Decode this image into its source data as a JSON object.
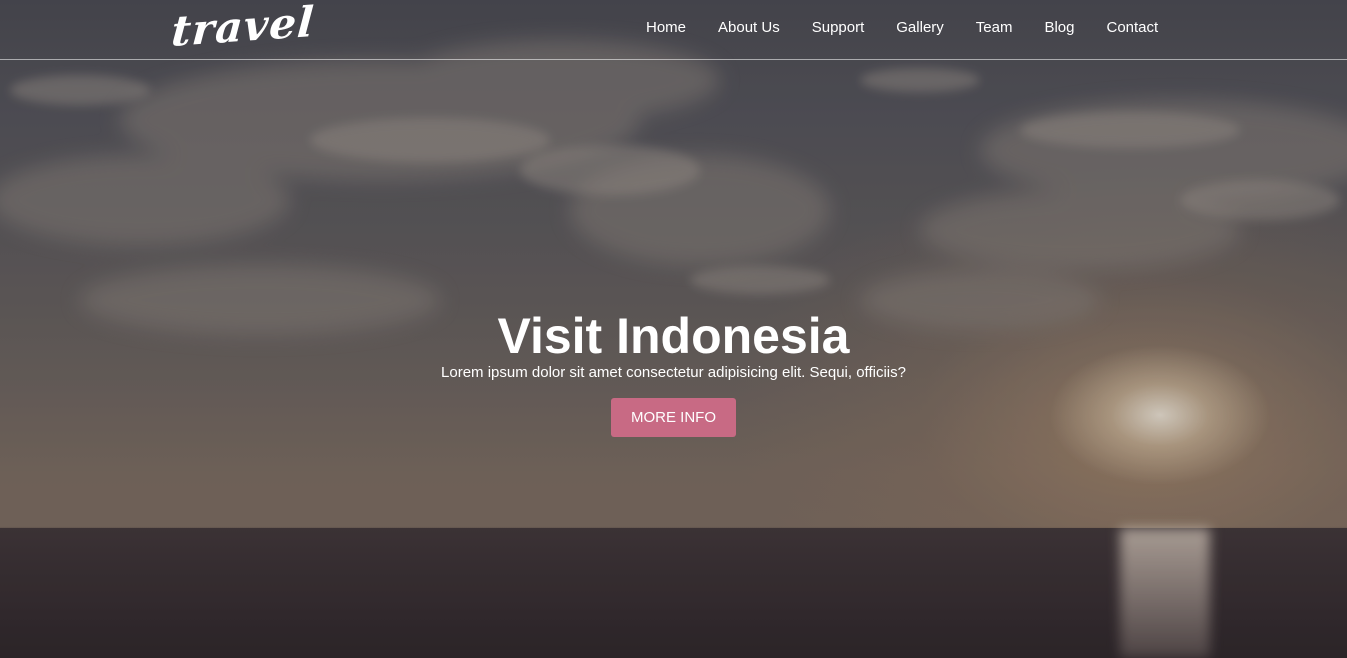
{
  "brand": {
    "logo_text": "travel"
  },
  "nav": {
    "items": [
      {
        "label": "Home"
      },
      {
        "label": "About Us"
      },
      {
        "label": "Support"
      },
      {
        "label": "Gallery"
      },
      {
        "label": "Team"
      },
      {
        "label": "Blog"
      },
      {
        "label": "Contact"
      }
    ]
  },
  "hero": {
    "title": "Visit Indonesia",
    "subtitle": "Lorem ipsum dolor sit amet consectetur adipisicing elit. Sequi, officiis?",
    "cta_label": "MORE INFO"
  },
  "colors": {
    "accent": "#c86a84",
    "text": "#ffffff"
  }
}
